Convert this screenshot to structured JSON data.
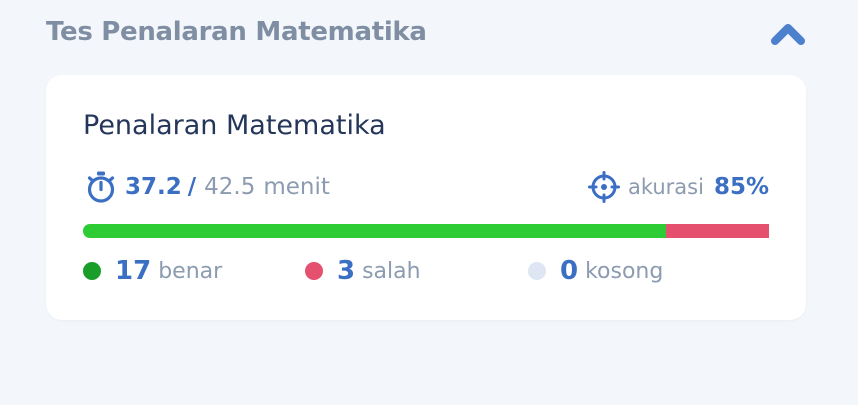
{
  "section": {
    "title": "Tes Penalaran Matematika",
    "toggle_icon": "chevron-up-icon"
  },
  "card": {
    "title": "Penalaran Matematika",
    "time": {
      "icon": "stopwatch-icon",
      "used": "37.2",
      "separator": "/",
      "total": "42.5",
      "unit": "menit"
    },
    "accuracy": {
      "icon": "crosshair-icon",
      "label": "akurasi",
      "value": "85%"
    },
    "progress": {
      "correct": 17,
      "wrong": 3,
      "empty": 0,
      "colors": {
        "correct": "#2ecc34",
        "wrong": "#e5506f",
        "empty": "#dde6f2"
      }
    },
    "legend": {
      "correct": {
        "count": "17",
        "label": "benar",
        "color": "#1a9e2a"
      },
      "wrong": {
        "count": "3",
        "label": "salah",
        "color": "#e5506f"
      },
      "empty": {
        "count": "0",
        "label": "kosong",
        "color": "#dde6f2"
      }
    }
  },
  "colors": {
    "accent": "#3b6fc4",
    "heading": "#24365a",
    "muted": "#8c9bb0",
    "section_title": "#7f8ea3",
    "background": "#f3f6fa",
    "card": "#ffffff"
  }
}
